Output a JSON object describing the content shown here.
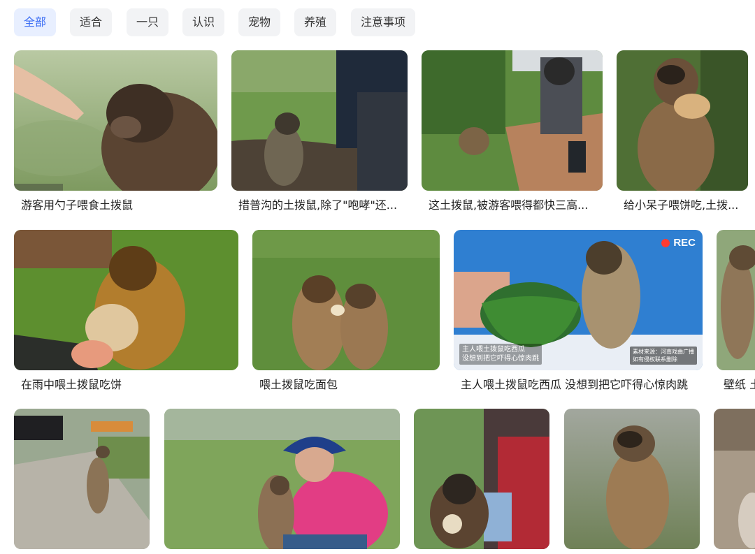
{
  "filters": [
    {
      "label": "全部",
      "active": true
    },
    {
      "label": "适合",
      "active": false
    },
    {
      "label": "一只",
      "active": false
    },
    {
      "label": "认识",
      "active": false
    },
    {
      "label": "宠物",
      "active": false
    },
    {
      "label": "养殖",
      "active": false
    },
    {
      "label": "注意事项",
      "active": false
    }
  ],
  "rows": [
    {
      "items": [
        {
          "caption": "游客用勺子喂食土拨鼠"
        },
        {
          "caption": "措普沟的土拨鼠,除了\"咆哮\"还..."
        },
        {
          "caption": "这土拨鼠,被游客喂得都快三高..."
        },
        {
          "caption": "给小呆子喂饼吃,土拨..."
        }
      ]
    },
    {
      "items": [
        {
          "caption": "在雨中喂土拨鼠吃饼"
        },
        {
          "caption": "喂土拨鼠吃面包"
        },
        {
          "caption": "主人喂土拨鼠吃西瓜 没想到把它吓得心惊肉跳",
          "rec_label": "REC",
          "overlay_text": [
            "主人喂土拨鼠吃西瓜",
            "没想到把它吓得心惊肉跳"
          ],
          "source_text": [
            "素材来源：河南戏曲广播",
            "如有侵权联系删除"
          ]
        },
        {
          "caption": "壁纸 土"
        }
      ]
    },
    {
      "items": [
        {
          "caption": ""
        },
        {
          "caption": ""
        },
        {
          "caption": ""
        },
        {
          "caption": ""
        },
        {
          "caption": ""
        }
      ]
    }
  ],
  "colors": {
    "chip_bg": "#f2f3f5",
    "chip_active_bg": "#e8efff",
    "chip_active_text": "#3a6cf4",
    "rec_dot": "#ff3b30"
  }
}
